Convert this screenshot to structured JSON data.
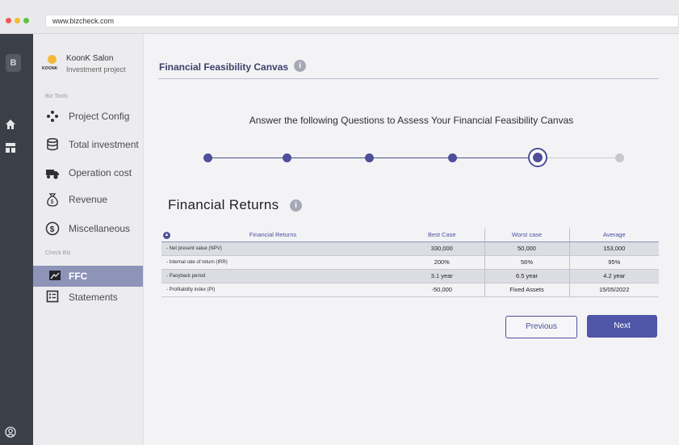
{
  "browser": {
    "url": "www.bizcheck.com"
  },
  "rail": {
    "brand_letter": "B",
    "icons": [
      "home-icon",
      "dashboard-icon",
      "user-circle-icon"
    ]
  },
  "sidebar": {
    "brand": {
      "logo_text": "KOONK",
      "name": "KoonK Salon",
      "subtitle": "Investment project"
    },
    "section_tools": "Biz Tools",
    "items": [
      {
        "label": "Project Config",
        "icon": "nodes-icon"
      },
      {
        "label": "Total investment",
        "icon": "database-icon"
      },
      {
        "label": "Operation cost",
        "icon": "truck-icon"
      },
      {
        "label": "Revenue",
        "icon": "money-bag-icon"
      },
      {
        "label": "Miscellaneous",
        "icon": "dollar-circle-icon"
      }
    ],
    "section_check": "Check Biz",
    "check_items": [
      {
        "label": "FFC",
        "icon": "canvas-icon",
        "active": true
      },
      {
        "label": "Statements",
        "icon": "statement-icon"
      }
    ]
  },
  "main": {
    "title": "Financial Feasibility Canvas",
    "info_glyph": "i",
    "question": "Answer the following Questions to Assess Your Financial Feasibility Canvas",
    "stepper": {
      "total_steps": 6,
      "current_step": 5
    },
    "section_title": "Financial Returns",
    "table": {
      "header_icon_glyph": "▲",
      "headers": [
        "Financial Returns",
        "Best Case",
        "Worst case",
        "Average"
      ],
      "rows": [
        {
          "label": "- Net present value (NPV)",
          "best": "330,000",
          "worst": "50,000",
          "average": "153,000"
        },
        {
          "label": "- Internal rate of return (IRR)",
          "best": "200%",
          "worst": "56%",
          "average": "95%"
        },
        {
          "label": "- Paoyback period",
          "best": "3.1 year",
          "worst": "6.5 year",
          "average": "4.2 year"
        },
        {
          "label": "- Profitability index (PI)",
          "best": "-50,000",
          "worst": "Fixed Assets",
          "average": "15/05/2022"
        }
      ]
    },
    "buttons": {
      "previous": "Previous",
      "next": "Next"
    }
  },
  "colors": {
    "accent": "#4d4f99",
    "active_nav": "#8e93b8",
    "rail": "#3b3f47",
    "next_button": "#4f55a8"
  }
}
